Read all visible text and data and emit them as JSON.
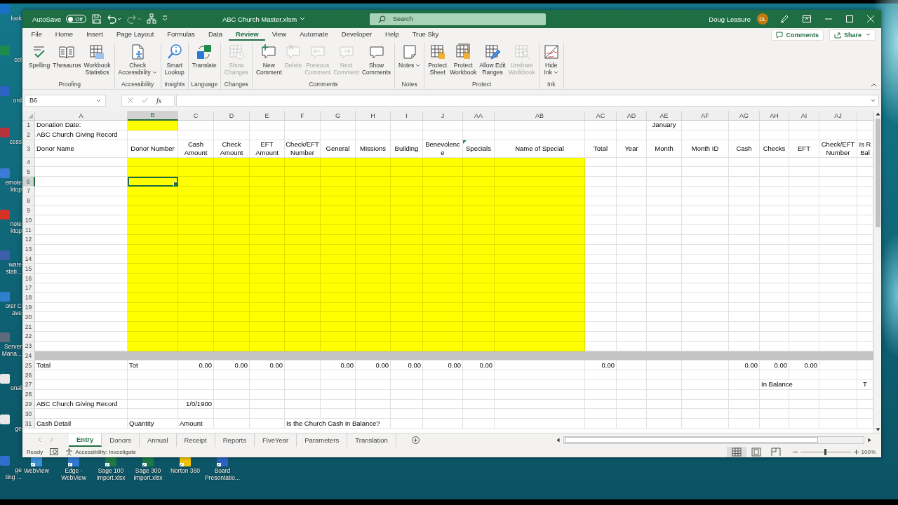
{
  "desktop": {
    "side_shortcuts": [
      {
        "label": "look",
        "color": "#1a6fc9"
      },
      {
        "label": "cel",
        "color": "#1e8a4c"
      },
      {
        "label": "ord",
        "color": "#2b62c4"
      },
      {
        "label": "cess",
        "color": "#b8323a"
      },
      {
        "label": "emote\nktop",
        "color": "#3a7bd5"
      },
      {
        "label": "note\nktop",
        "color": "#d93025"
      },
      {
        "label": "ware\nstati...",
        "color": "#3b5fa8"
      },
      {
        "label": "orer C\nave",
        "color": "#2f7fd0"
      },
      {
        "label": "Server\nMana...",
        "color": "#5f6b7a"
      },
      {
        "label": "onal",
        "color": "#e8e8e8"
      },
      {
        "label": "ge",
        "color": "#e8e8e8"
      },
      {
        "label": "ge\nting ...",
        "color": "#2f6fd0"
      }
    ],
    "shortcuts": [
      {
        "label": "WebView",
        "color": "#3a8fd8"
      },
      {
        "label": "Edge -\nWebView",
        "color": "#2f7ad0"
      },
      {
        "label": "Sage 100\nImport.xlsx",
        "color": "#1e7a45"
      },
      {
        "label": "Sage 300\nImport.xlsx",
        "color": "#1e7a45"
      },
      {
        "label": "Norton 360",
        "color": "#f5c400"
      },
      {
        "label": "Board\nPresentatio...",
        "color": "#2b62c4"
      }
    ]
  },
  "title_bar": {
    "autosave": {
      "label": "AutoSave",
      "state": "Off",
      "on": false
    },
    "quick_access": [
      {
        "kind": "save",
        "disabled": false
      },
      {
        "kind": "undo",
        "disabled": false
      },
      {
        "kind": "redo",
        "disabled": true
      },
      {
        "kind": "flow",
        "disabled": false
      },
      {
        "kind": "customize",
        "disabled": false
      }
    ],
    "title": "ABC Church Master.xlsm",
    "search": {
      "placeholder": "Search"
    },
    "user": "Doug Leasure",
    "avatar": "DL"
  },
  "menu_tabs": [
    {
      "label": "File",
      "selected": false
    },
    {
      "label": "Home",
      "selected": false
    },
    {
      "label": "Insert",
      "selected": false
    },
    {
      "label": "Page Layout",
      "selected": false
    },
    {
      "label": "Formulas",
      "selected": false
    },
    {
      "label": "Data",
      "selected": false
    },
    {
      "label": "Review",
      "selected": true
    },
    {
      "label": "View",
      "selected": false
    },
    {
      "label": "Automate",
      "selected": false
    },
    {
      "label": "Developer",
      "selected": false
    },
    {
      "label": "Help",
      "selected": false
    },
    {
      "label": "True Sky",
      "selected": false
    }
  ],
  "comments_button": "Comments",
  "share_button": "Share",
  "ribbon": [
    {
      "label": "Proofing",
      "buttons": [
        {
          "label": "Spelling",
          "kind": "spelling",
          "disabled": false
        },
        {
          "label": "Thesaurus",
          "kind": "thesaurus",
          "disabled": false
        },
        {
          "label": "Workbook\nStatistics",
          "kind": "statistics",
          "disabled": false
        }
      ]
    },
    {
      "label": "Accessibility",
      "buttons": [
        {
          "label": "Check\nAccessibility",
          "kind": "accessibility",
          "disabled": false,
          "dropdown": true
        }
      ]
    },
    {
      "label": "Insights",
      "buttons": [
        {
          "label": "Smart\nLookup",
          "kind": "lookup",
          "disabled": false
        }
      ]
    },
    {
      "label": "Language",
      "buttons": [
        {
          "label": "Translate",
          "kind": "translate",
          "disabled": false
        }
      ]
    },
    {
      "label": "Changes",
      "buttons": [
        {
          "label": "Show\nChanges",
          "kind": "changes",
          "disabled": true
        }
      ]
    },
    {
      "label": "Comments",
      "buttons": [
        {
          "label": "New\nComment",
          "kind": "newcomment",
          "disabled": false
        },
        {
          "label": "Delete",
          "kind": "delete",
          "disabled": true
        },
        {
          "label": "Previous\nComment",
          "kind": "previous",
          "disabled": true
        },
        {
          "label": "Next\nComment",
          "kind": "next",
          "disabled": true
        },
        {
          "label": "Show\nComments",
          "kind": "showcomments",
          "disabled": false
        }
      ]
    },
    {
      "label": "Notes",
      "buttons": [
        {
          "label": "Notes",
          "kind": "notes",
          "disabled": false,
          "dropdown": true
        }
      ]
    },
    {
      "label": "Protect",
      "buttons": [
        {
          "label": "Protect\nSheet",
          "kind": "protectsheet",
          "disabled": false
        },
        {
          "label": "Protect\nWorkbook",
          "kind": "protectworkbook",
          "disabled": false
        },
        {
          "label": "Allow Edit\nRanges",
          "kind": "ranges",
          "disabled": false
        },
        {
          "label": "Unshare\nWorkbook",
          "kind": "unshare",
          "disabled": true
        }
      ]
    },
    {
      "label": "Ink",
      "buttons": [
        {
          "label": "Hide\nInk",
          "kind": "ink",
          "disabled": false,
          "dropdown": true
        }
      ]
    }
  ],
  "formula_bar": {
    "name_box": "B6",
    "function_label": "fx"
  },
  "sheet": {
    "columns": [
      {
        "letter": "A",
        "selected": false
      },
      {
        "letter": "B",
        "selected": true
      },
      {
        "letter": "C",
        "selected": false
      },
      {
        "letter": "D",
        "selected": false
      },
      {
        "letter": "E",
        "selected": false
      },
      {
        "letter": "F",
        "selected": false
      },
      {
        "letter": "G",
        "selected": false
      },
      {
        "letter": "H",
        "selected": false
      },
      {
        "letter": "I",
        "selected": false
      },
      {
        "letter": "J",
        "selected": false
      },
      {
        "letter": "AA",
        "selected": false
      },
      {
        "letter": "AB",
        "selected": false
      },
      {
        "letter": "AC",
        "selected": false
      },
      {
        "letter": "AD",
        "selected": false
      },
      {
        "letter": "AE",
        "selected": false
      },
      {
        "letter": "AF",
        "selected": false
      },
      {
        "letter": "AG",
        "selected": false
      },
      {
        "letter": "AH",
        "selected": false
      },
      {
        "letter": "AI",
        "selected": false
      },
      {
        "letter": "AJ",
        "selected": false
      }
    ],
    "rows": [
      {
        "number": "1",
        "selected": false,
        "cells": [
          {
            "text": "Donation Date:",
            "kind": "text"
          },
          {
            "kind": "input"
          },
          {
            "kind": "blank"
          },
          {
            "kind": "blank"
          },
          {
            "kind": "blank"
          },
          {
            "kind": "blank"
          },
          {
            "kind": "blank"
          },
          {
            "kind": "blank"
          },
          {
            "kind": "blank"
          },
          {
            "kind": "blank"
          },
          {
            "kind": "blank"
          },
          {
            "kind": "blank"
          },
          {
            "kind": "blank"
          },
          {
            "kind": "blank"
          },
          {
            "text": "January",
            "kind": "header"
          }
        ]
      },
      {
        "number": "2",
        "selected": false,
        "cells": [
          {
            "text": "ABC Church Giving Record",
            "kind": "text"
          }
        ]
      },
      {
        "number": "3",
        "selected": false,
        "cells": [
          {
            "text": "Donor Name",
            "kind": "text"
          },
          {
            "text": "Donor Number",
            "kind": "header"
          },
          {
            "text": "Cash\nAmount",
            "kind": "header"
          },
          {
            "text": "Check\nAmount",
            "kind": "header"
          },
          {
            "text": "EFT\nAmount",
            "kind": "header"
          },
          {
            "text": "Check/EFT\nNumber",
            "kind": "header"
          },
          {
            "text": "General",
            "kind": "header"
          },
          {
            "text": "Missions",
            "kind": "header"
          },
          {
            "text": "Building",
            "kind": "header"
          },
          {
            "text": "Benevolenc\ne",
            "kind": "header"
          },
          {
            "text": "Specials",
            "kind": "header",
            "marker": true
          },
          {
            "text": "Name of Special",
            "kind": "header"
          },
          {
            "text": "Total",
            "kind": "header"
          },
          {
            "text": "Year",
            "kind": "header"
          },
          {
            "text": "Month",
            "kind": "header"
          },
          {
            "text": "Month ID",
            "kind": "header"
          },
          {
            "text": "Cash",
            "kind": "header"
          },
          {
            "text": "Checks",
            "kind": "header"
          },
          {
            "text": "EFT",
            "kind": "header"
          },
          {
            "text": "Check/EFT\nNumber",
            "kind": "header"
          },
          {
            "text": "Is R\nBal",
            "kind": "header"
          }
        ]
      },
      {
        "number": "4",
        "selected": false,
        "cells": [
          {
            "kind": "blank"
          },
          {
            "kind": "input"
          },
          {
            "kind": "input"
          },
          {
            "kind": "input"
          },
          {
            "kind": "input"
          },
          {
            "kind": "input"
          },
          {
            "kind": "input"
          },
          {
            "kind": "input"
          },
          {
            "kind": "input"
          },
          {
            "kind": "input"
          },
          {
            "kind": "input"
          },
          {
            "kind": "input"
          }
        ]
      },
      {
        "number": "5",
        "selected": false,
        "cells": [
          {
            "kind": "blank"
          },
          {
            "kind": "input"
          },
          {
            "kind": "input"
          },
          {
            "kind": "input"
          },
          {
            "kind": "input"
          },
          {
            "kind": "input"
          },
          {
            "kind": "input"
          },
          {
            "kind": "input"
          },
          {
            "kind": "input"
          },
          {
            "kind": "input"
          },
          {
            "kind": "input"
          },
          {
            "kind": "input"
          }
        ]
      },
      {
        "number": "6",
        "selected": true,
        "cells": [
          {
            "kind": "blank"
          },
          {
            "kind": "input"
          },
          {
            "kind": "input"
          },
          {
            "kind": "input"
          },
          {
            "kind": "input"
          },
          {
            "kind": "input"
          },
          {
            "kind": "input"
          },
          {
            "kind": "input"
          },
          {
            "kind": "input"
          },
          {
            "kind": "input"
          },
          {
            "kind": "input"
          },
          {
            "kind": "input"
          }
        ]
      },
      {
        "number": "7",
        "selected": false,
        "cells": [
          {
            "kind": "blank"
          },
          {
            "kind": "input"
          },
          {
            "kind": "input"
          },
          {
            "kind": "input"
          },
          {
            "kind": "input"
          },
          {
            "kind": "input"
          },
          {
            "kind": "input"
          },
          {
            "kind": "input"
          },
          {
            "kind": "input"
          },
          {
            "kind": "input"
          },
          {
            "kind": "input"
          },
          {
            "kind": "input"
          }
        ]
      },
      {
        "number": "8",
        "selected": false,
        "cells": [
          {
            "kind": "blank"
          },
          {
            "kind": "input"
          },
          {
            "kind": "input"
          },
          {
            "kind": "input"
          },
          {
            "kind": "input"
          },
          {
            "kind": "input"
          },
          {
            "kind": "input"
          },
          {
            "kind": "input"
          },
          {
            "kind": "input"
          },
          {
            "kind": "input"
          },
          {
            "kind": "input"
          },
          {
            "kind": "input"
          }
        ]
      },
      {
        "number": "9",
        "selected": false,
        "cells": [
          {
            "kind": "blank"
          },
          {
            "kind": "input"
          },
          {
            "kind": "input"
          },
          {
            "kind": "input"
          },
          {
            "kind": "input"
          },
          {
            "kind": "input"
          },
          {
            "kind": "input"
          },
          {
            "kind": "input"
          },
          {
            "kind": "input"
          },
          {
            "kind": "input"
          },
          {
            "kind": "input"
          },
          {
            "kind": "input"
          }
        ]
      },
      {
        "number": "10",
        "selected": false,
        "cells": [
          {
            "kind": "blank"
          },
          {
            "kind": "input"
          },
          {
            "kind": "input"
          },
          {
            "kind": "input"
          },
          {
            "kind": "input"
          },
          {
            "kind": "input"
          },
          {
            "kind": "input"
          },
          {
            "kind": "input"
          },
          {
            "kind": "input"
          },
          {
            "kind": "input"
          },
          {
            "kind": "input"
          },
          {
            "kind": "input"
          }
        ]
      },
      {
        "number": "11",
        "selected": false,
        "cells": [
          {
            "kind": "blank"
          },
          {
            "kind": "input"
          },
          {
            "kind": "input"
          },
          {
            "kind": "input"
          },
          {
            "kind": "input"
          },
          {
            "kind": "input"
          },
          {
            "kind": "input"
          },
          {
            "kind": "input"
          },
          {
            "kind": "input"
          },
          {
            "kind": "input"
          },
          {
            "kind": "input"
          },
          {
            "kind": "input"
          }
        ]
      },
      {
        "number": "12",
        "selected": false,
        "cells": [
          {
            "kind": "blank"
          },
          {
            "kind": "input"
          },
          {
            "kind": "input"
          },
          {
            "kind": "input"
          },
          {
            "kind": "input"
          },
          {
            "kind": "input"
          },
          {
            "kind": "input"
          },
          {
            "kind": "input"
          },
          {
            "kind": "input"
          },
          {
            "kind": "input"
          },
          {
            "kind": "input"
          },
          {
            "kind": "input"
          }
        ]
      },
      {
        "number": "13",
        "selected": false,
        "cells": [
          {
            "kind": "blank"
          },
          {
            "kind": "input"
          },
          {
            "kind": "input"
          },
          {
            "kind": "input"
          },
          {
            "kind": "input"
          },
          {
            "kind": "input"
          },
          {
            "kind": "input"
          },
          {
            "kind": "input"
          },
          {
            "kind": "input"
          },
          {
            "kind": "input"
          },
          {
            "kind": "input"
          },
          {
            "kind": "input"
          }
        ]
      },
      {
        "number": "14",
        "selected": false,
        "cells": [
          {
            "kind": "blank"
          },
          {
            "kind": "input"
          },
          {
            "kind": "input"
          },
          {
            "kind": "input"
          },
          {
            "kind": "input"
          },
          {
            "kind": "input"
          },
          {
            "kind": "input"
          },
          {
            "kind": "input"
          },
          {
            "kind": "input"
          },
          {
            "kind": "input"
          },
          {
            "kind": "input"
          },
          {
            "kind": "input"
          }
        ]
      },
      {
        "number": "15",
        "selected": false,
        "cells": [
          {
            "kind": "blank"
          },
          {
            "kind": "input"
          },
          {
            "kind": "input"
          },
          {
            "kind": "input"
          },
          {
            "kind": "input"
          },
          {
            "kind": "input"
          },
          {
            "kind": "input"
          },
          {
            "kind": "input"
          },
          {
            "kind": "input"
          },
          {
            "kind": "input"
          },
          {
            "kind": "input"
          },
          {
            "kind": "input"
          }
        ]
      },
      {
        "number": "16",
        "selected": false,
        "cells": [
          {
            "kind": "blank"
          },
          {
            "kind": "input"
          },
          {
            "kind": "input"
          },
          {
            "kind": "input"
          },
          {
            "kind": "input"
          },
          {
            "kind": "input"
          },
          {
            "kind": "input"
          },
          {
            "kind": "input"
          },
          {
            "kind": "input"
          },
          {
            "kind": "input"
          },
          {
            "kind": "input"
          },
          {
            "kind": "input"
          }
        ]
      },
      {
        "number": "17",
        "selected": false,
        "cells": [
          {
            "kind": "blank"
          },
          {
            "kind": "input"
          },
          {
            "kind": "input"
          },
          {
            "kind": "input"
          },
          {
            "kind": "input"
          },
          {
            "kind": "input"
          },
          {
            "kind": "input"
          },
          {
            "kind": "input"
          },
          {
            "kind": "input"
          },
          {
            "kind": "input"
          },
          {
            "kind": "input"
          },
          {
            "kind": "input"
          }
        ]
      },
      {
        "number": "18",
        "selected": false,
        "cells": [
          {
            "kind": "blank"
          },
          {
            "kind": "input"
          },
          {
            "kind": "input"
          },
          {
            "kind": "input"
          },
          {
            "kind": "input"
          },
          {
            "kind": "input"
          },
          {
            "kind": "input"
          },
          {
            "kind": "input"
          },
          {
            "kind": "input"
          },
          {
            "kind": "input"
          },
          {
            "kind": "input"
          },
          {
            "kind": "input"
          }
        ]
      },
      {
        "number": "19",
        "selected": false,
        "cells": [
          {
            "kind": "blank"
          },
          {
            "kind": "input"
          },
          {
            "kind": "input"
          },
          {
            "kind": "input"
          },
          {
            "kind": "input"
          },
          {
            "kind": "input"
          },
          {
            "kind": "input"
          },
          {
            "kind": "input"
          },
          {
            "kind": "input"
          },
          {
            "kind": "input"
          },
          {
            "kind": "input"
          },
          {
            "kind": "input"
          }
        ]
      },
      {
        "number": "20",
        "selected": false,
        "cells": [
          {
            "kind": "blank"
          },
          {
            "kind": "input"
          },
          {
            "kind": "input"
          },
          {
            "kind": "input"
          },
          {
            "kind": "input"
          },
          {
            "kind": "input"
          },
          {
            "kind": "input"
          },
          {
            "kind": "input"
          },
          {
            "kind": "input"
          },
          {
            "kind": "input"
          },
          {
            "kind": "input"
          },
          {
            "kind": "input"
          }
        ]
      },
      {
        "number": "21",
        "selected": false,
        "cells": [
          {
            "kind": "blank"
          },
          {
            "kind": "input"
          },
          {
            "kind": "input"
          },
          {
            "kind": "input"
          },
          {
            "kind": "input"
          },
          {
            "kind": "input"
          },
          {
            "kind": "input"
          },
          {
            "kind": "input"
          },
          {
            "kind": "input"
          },
          {
            "kind": "input"
          },
          {
            "kind": "input"
          },
          {
            "kind": "input"
          }
        ]
      },
      {
        "number": "22",
        "selected": false,
        "cells": [
          {
            "kind": "blank"
          },
          {
            "kind": "input"
          },
          {
            "kind": "input"
          },
          {
            "kind": "input"
          },
          {
            "kind": "input"
          },
          {
            "kind": "input"
          },
          {
            "kind": "input"
          },
          {
            "kind": "input"
          },
          {
            "kind": "input"
          },
          {
            "kind": "input"
          },
          {
            "kind": "input"
          },
          {
            "kind": "input"
          }
        ]
      },
      {
        "number": "23",
        "selected": false,
        "cells": [
          {
            "kind": "blank"
          },
          {
            "kind": "input"
          },
          {
            "kind": "input"
          },
          {
            "kind": "input"
          },
          {
            "kind": "input"
          },
          {
            "kind": "input"
          },
          {
            "kind": "input"
          },
          {
            "kind": "input"
          },
          {
            "kind": "input"
          },
          {
            "kind": "input"
          },
          {
            "kind": "input"
          },
          {
            "kind": "input"
          }
        ]
      },
      {
        "number": "24",
        "selected": false,
        "kind": "separator"
      },
      {
        "number": "25",
        "selected": false,
        "cells": [
          {
            "text": "Total",
            "kind": "text"
          },
          {
            "text": "Tot",
            "kind": "text"
          },
          {
            "text": "0.00",
            "kind": "number"
          },
          {
            "text": "0.00",
            "kind": "number"
          },
          {
            "text": "0.00",
            "kind": "number"
          },
          {
            "kind": "blank"
          },
          {
            "text": "0.00",
            "kind": "number"
          },
          {
            "text": "0.00",
            "kind": "number"
          },
          {
            "text": "0.00",
            "kind": "number"
          },
          {
            "text": "0.00",
            "kind": "number"
          },
          {
            "text": "0.00",
            "kind": "number"
          },
          {
            "kind": "blank"
          },
          {
            "text": "0.00",
            "kind": "number"
          },
          {
            "kind": "blank"
          },
          {
            "kind": "blank"
          },
          {
            "kind": "blank"
          },
          {
            "text": "0.00",
            "kind": "number"
          },
          {
            "text": "0.00",
            "kind": "number"
          },
          {
            "text": "0.00",
            "kind": "number"
          }
        ]
      },
      {
        "number": "26",
        "selected": false
      },
      {
        "number": "27",
        "selected": false,
        "cells": [
          {
            "kind": "blank"
          },
          {
            "kind": "blank"
          },
          {
            "kind": "blank"
          },
          {
            "kind": "blank"
          },
          {
            "kind": "blank"
          },
          {
            "kind": "blank"
          },
          {
            "kind": "blank"
          },
          {
            "kind": "blank"
          },
          {
            "kind": "blank"
          },
          {
            "kind": "blank"
          },
          {
            "kind": "blank"
          },
          {
            "kind": "blank"
          },
          {
            "kind": "blank"
          },
          {
            "kind": "blank"
          },
          {
            "kind": "blank"
          },
          {
            "kind": "blank"
          },
          {
            "kind": "blank"
          },
          {
            "text": "In Balance",
            "kind": "text"
          },
          {
            "kind": "covered"
          },
          {
            "kind": "blank"
          },
          {
            "text": "T",
            "kind": "header"
          }
        ]
      },
      {
        "number": "28",
        "selected": false
      },
      {
        "number": "29",
        "selected": false,
        "cells": [
          {
            "text": "ABC Church Giving Record",
            "kind": "text"
          },
          {
            "kind": "blank"
          },
          {
            "text": "1/0/1900",
            "kind": "number"
          }
        ]
      },
      {
        "number": "30",
        "selected": false
      },
      {
        "number": "31",
        "selected": false,
        "cells": [
          {
            "text": "Cash Detail",
            "kind": "text"
          },
          {
            "text": "Quantity",
            "kind": "text"
          },
          {
            "text": "Amount",
            "kind": "text"
          },
          {
            "kind": "blank"
          },
          {
            "kind": "blank"
          },
          {
            "text": "Is the Church Cash in Balance?",
            "kind": "text"
          },
          {
            "kind": "covered"
          },
          {
            "kind": "covered"
          }
        ]
      }
    ]
  },
  "sheet_tabs": [
    {
      "label": "Entry",
      "selected": true
    },
    {
      "label": "Donors",
      "selected": false
    },
    {
      "label": "Annual",
      "selected": false
    },
    {
      "label": "Receipt",
      "selected": false
    },
    {
      "label": "Reports",
      "selected": false
    },
    {
      "label": "FiveYear",
      "selected": false
    },
    {
      "label": "Parameters",
      "selected": false
    },
    {
      "label": "Translation",
      "selected": false
    }
  ],
  "status_bar": {
    "mode": "Ready",
    "accessibility": "Accessibility: Investigate",
    "views": [
      {
        "kind": "normal",
        "selected": true
      },
      {
        "kind": "layout",
        "selected": false
      },
      {
        "kind": "pagebreak",
        "selected": false
      }
    ],
    "zoom": {
      "level": 0.5,
      "reading": "100%"
    }
  }
}
